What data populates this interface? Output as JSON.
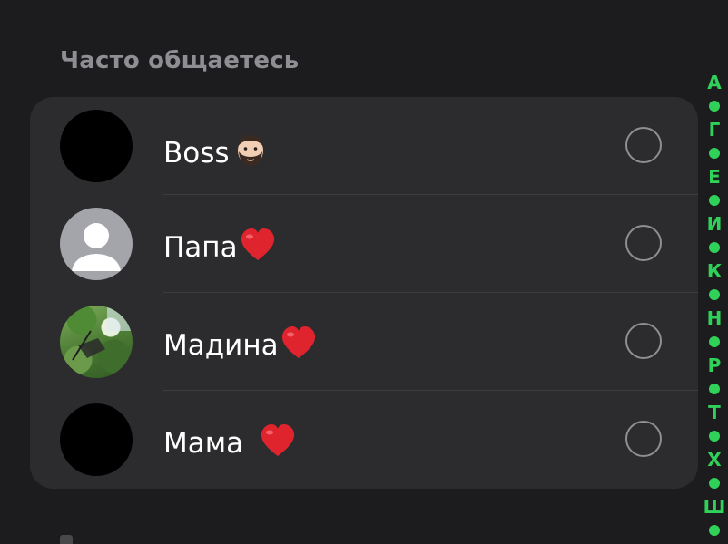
{
  "section": {
    "title": "Часто общаетесь"
  },
  "contacts": [
    {
      "name": "Boss",
      "emoji": "man-beard-emoji",
      "avatar": "black",
      "selected": false
    },
    {
      "name": "Папа",
      "emoji": "red-heart-emoji",
      "avatar": "placeholder",
      "selected": false
    },
    {
      "name": "Мадина",
      "emoji": "red-heart-emoji",
      "avatar": "photo",
      "selected": false
    },
    {
      "name": "Мама ",
      "emoji": "red-heart-emoji",
      "avatar": "black",
      "selected": false
    }
  ],
  "index_bar": {
    "letters": [
      "А",
      "Г",
      "Е",
      "И",
      "К",
      "Н",
      "Р",
      "Т",
      "Х",
      "Ш"
    ],
    "color": "#30d158"
  },
  "colors": {
    "background": "#1c1c1e",
    "card": "#2c2c2e",
    "section_title": "#8e8e93",
    "radio": "#8e8e93",
    "accent": "#30d158"
  }
}
